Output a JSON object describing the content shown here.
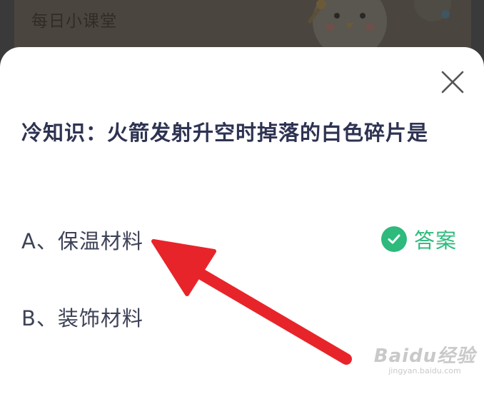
{
  "background": {
    "title": "每日小课堂"
  },
  "quiz": {
    "question": "冷知识：火箭发射升空时掉落的白色碎片是",
    "options": [
      {
        "label": "A、保温材料",
        "is_answer": true
      },
      {
        "label": "B、装饰材料",
        "is_answer": false
      }
    ],
    "answer_label": "答案"
  },
  "watermark": {
    "brand": "Baidu经验",
    "url": "jingyan.baidu.com"
  },
  "icons": {
    "close": "close-icon",
    "check": "check-circle-icon",
    "arrow": "red-arrow-annotation"
  },
  "colors": {
    "accent_green": "#2dba7c",
    "question_text": "#2e3352",
    "arrow_red": "#e8242b"
  }
}
